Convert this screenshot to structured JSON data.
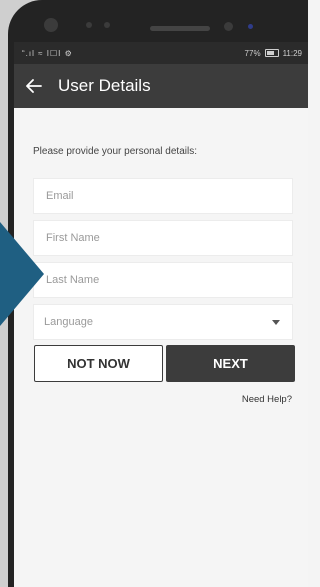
{
  "status_bar": {
    "left_icons": "“.ıl ≈ I☐I ⚙",
    "battery_percent": "77%",
    "time": "11:29"
  },
  "app_bar": {
    "title": "User Details",
    "back_icon": "arrow-left-icon"
  },
  "form": {
    "prompt": "Please provide your personal details:",
    "email_placeholder": "Email",
    "first_name_placeholder": "First Name",
    "last_name_placeholder": "Last Name",
    "language_value": "Language"
  },
  "actions": {
    "not_now_label": "NOT NOW",
    "next_label": "NEXT",
    "help_label": "Need Help?"
  },
  "colors": {
    "app_bar": "#3c3c3c",
    "status_bar": "#2b2b2b",
    "screen_background": "#f5f5f5",
    "pointer_arrow": "#1f5f82"
  }
}
